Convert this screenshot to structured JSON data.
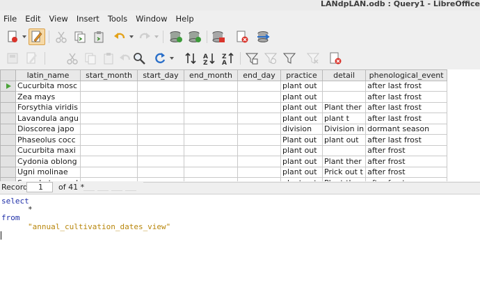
{
  "window": {
    "title": "LANdpLAN.odb : Query1 - LibreOffice"
  },
  "menu": [
    "File",
    "Edit",
    "View",
    "Insert",
    "Tools",
    "Window",
    "Help"
  ],
  "toolbar1": {
    "icons": [
      "new-document-icon",
      "edit-pencil-icon",
      "cut-icon",
      "copy-icon",
      "paste-icon",
      "undo-icon",
      "redo-icon",
      "run-query-icon",
      "clear-query-icon",
      "table-query-icon",
      "close-red-icon",
      "switch-design-icon"
    ]
  },
  "toolbar2": {
    "icons": [
      "save-record-icon",
      "edit-data-icon",
      "cut-icon",
      "copy-icon",
      "paste-icon",
      "undo-record-icon",
      "find-record-icon",
      "refresh-icon",
      "sort-icon",
      "sort-ascending-icon",
      "sort-descending-icon",
      "autofilter-icon",
      "standard-filter-icon",
      "apply-filter-icon",
      "reset-filter-icon",
      "delete-record-icon"
    ]
  },
  "grid": {
    "columns": [
      "latin_name",
      "start_month",
      "start_day",
      "end_month",
      "end_day",
      "practice",
      "detail",
      "phenological_event"
    ],
    "rows": [
      [
        "Cucurbita mosc",
        "",
        "",
        "",
        "",
        "plant out",
        "",
        "after last frost"
      ],
      [
        "Zea mays",
        "",
        "",
        "",
        "",
        "plant out",
        "",
        "after last frost"
      ],
      [
        "Forsythia viridis",
        "",
        "",
        "",
        "",
        "plant out",
        "Plant ther",
        "after last frost"
      ],
      [
        "Lavandula angu",
        "",
        "",
        "",
        "",
        "plant out",
        "plant t",
        "after last frost"
      ],
      [
        "Dioscorea japo",
        "",
        "",
        "",
        "",
        "division",
        "Division in",
        "dormant season"
      ],
      [
        "Phaseolus cocc",
        "",
        "",
        "",
        "",
        "Plant out",
        "plant out",
        "after last frost"
      ],
      [
        "Cucurbita maxi",
        "",
        "",
        "",
        "",
        "plant out",
        "",
        "after frost"
      ],
      [
        "Cydonia oblong",
        "",
        "",
        "",
        "",
        "plant out",
        "Plant ther",
        "after frost"
      ],
      [
        "Ugni molinae",
        "",
        "",
        "",
        "",
        "plant out",
        "Prick out t",
        "after frost"
      ],
      [
        "Symphytum upl",
        "",
        "",
        "",
        "",
        "plant out",
        "Plant ther",
        "after frost"
      ]
    ]
  },
  "record_bar": {
    "label": "Record",
    "current": "1",
    "of_text": "of 41 *"
  },
  "sql": {
    "line1": "select",
    "line2": "*",
    "line3": "from",
    "line4": "\"annual_cultivation_dates_view\""
  },
  "colors": {
    "keyword": "#1f2fa8",
    "string": "#b8860b",
    "current_row_marker": "#4aa338"
  }
}
